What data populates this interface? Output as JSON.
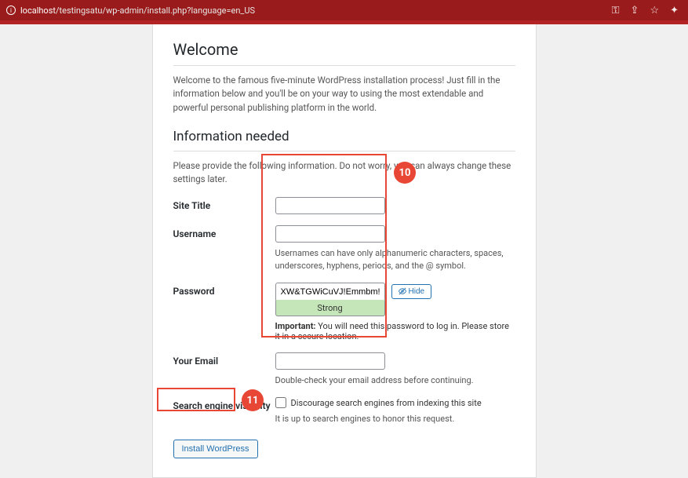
{
  "browser": {
    "domain": "localhost",
    "path": "/testingsatu/wp-admin/install.php?language=en_US"
  },
  "page": {
    "welcome_heading": "Welcome",
    "welcome_text": "Welcome to the famous five-minute WordPress installation process! Just fill in the information below and you'll be on your way to using the most extendable and powerful personal publishing platform in the world.",
    "info_heading": "Information needed",
    "info_text": "Please provide the following information. Do not worry, you can always change these settings later."
  },
  "form": {
    "site_title": {
      "label": "Site Title",
      "value": ""
    },
    "username": {
      "label": "Username",
      "value": "",
      "help": "Usernames can have only alphanumeric characters, spaces, underscores, hyphens, periods, and the @ symbol."
    },
    "password": {
      "label": "Password",
      "value": "XW&TGWiCuVJ!Emmbm!",
      "hide_label": "Hide",
      "strength": "Strong",
      "important_prefix": "Important:",
      "important_text": " You will need this password to log in. Please store it in a secure location."
    },
    "email": {
      "label": "Your Email",
      "value": "",
      "help": "Double-check your email address before continuing."
    },
    "search_visibility": {
      "label": "Search engine visibility",
      "checkbox_label": "Discourage search engines from indexing this site",
      "note": "It is up to search engines to honor this request."
    },
    "submit_label": "Install WordPress"
  },
  "annotations": {
    "num10": "10",
    "num11": "11"
  }
}
